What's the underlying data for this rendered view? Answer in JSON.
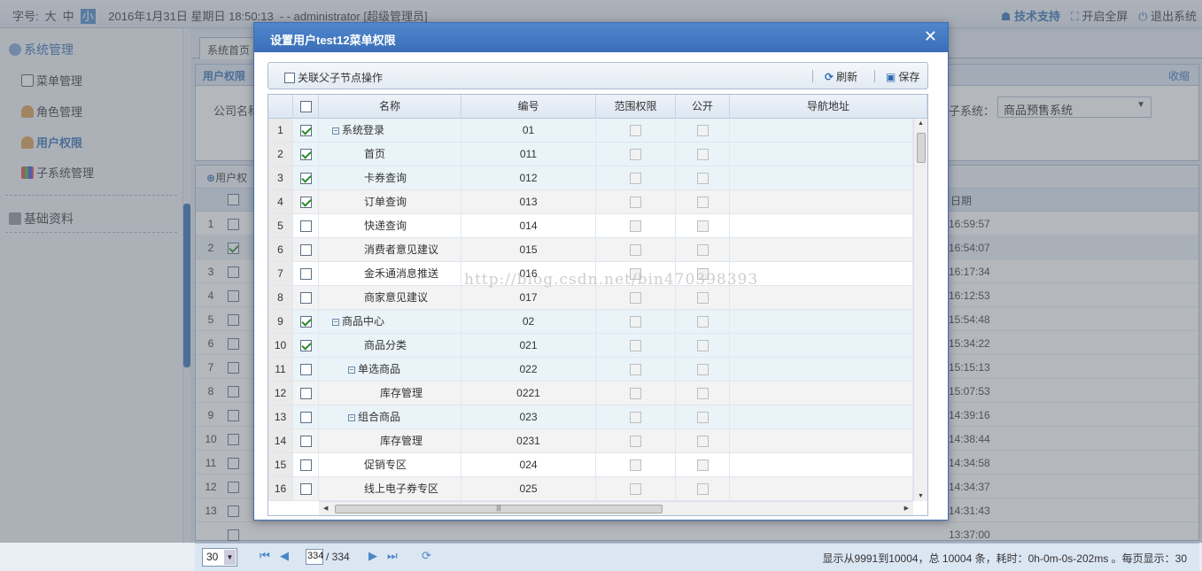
{
  "topbar": {
    "font_label": "字号:",
    "font_large": "大",
    "font_mid": "中",
    "font_small": "小",
    "datetime": "2016年1月31日 星期日 18:50:13",
    "user": "- - administrator [超级管理员]",
    "support": "技术支持",
    "fullscreen": "开启全屏",
    "logout": "退出系统"
  },
  "sidebar": {
    "group1": "系统管理",
    "items": [
      "菜单管理",
      "角色管理",
      "用户权限",
      "子系统管理"
    ],
    "group2": "基础资料"
  },
  "main": {
    "tab": "系统首页",
    "panel_title": "用户权限",
    "collapse": "收缩",
    "company_label": "公司名称",
    "subsystem_label": "子系统：",
    "subsystem_value": "商品预售系统",
    "toolbar_label": "用户权",
    "date_header": "日期"
  },
  "bg_rows": [
    {
      "n": "1",
      "on": false,
      "t": "16:59:57"
    },
    {
      "n": "2",
      "on": true,
      "t": "16:54:07"
    },
    {
      "n": "3",
      "on": false,
      "t": "16:17:34"
    },
    {
      "n": "4",
      "on": false,
      "t": "16:12:53"
    },
    {
      "n": "5",
      "on": false,
      "t": "15:54:48"
    },
    {
      "n": "6",
      "on": false,
      "t": "15:34:22"
    },
    {
      "n": "7",
      "on": false,
      "t": "15:15:13"
    },
    {
      "n": "8",
      "on": false,
      "t": "15:07:53"
    },
    {
      "n": "9",
      "on": false,
      "t": "14:39:16"
    },
    {
      "n": "10",
      "on": false,
      "t": "14:38:44"
    },
    {
      "n": "11",
      "on": false,
      "t": "14:34:58"
    },
    {
      "n": "12",
      "on": false,
      "t": "14:34:37"
    },
    {
      "n": "13",
      "on": false,
      "t": "14:31:43"
    },
    {
      "n": "",
      "on": false,
      "t": "13:37:00"
    }
  ],
  "pager": {
    "page_size": "30",
    "current": "334",
    "total": "/ 334",
    "info": "显示从9991到10004，总 10004 条，耗时：0h-0m-0s-202ms 。每页显示：30"
  },
  "dialog": {
    "title": "设置用户test12菜单权限",
    "link_label": "关联父子节点操作",
    "refresh": "刷新",
    "save": "保存",
    "headers": [
      "名称",
      "编号",
      "范围权限",
      "公开",
      "导航地址"
    ],
    "rows": [
      {
        "n": "1",
        "on": true,
        "name": "系统登录",
        "code": "01",
        "lvl": 0,
        "tg": "−"
      },
      {
        "n": "2",
        "on": true,
        "name": "首页",
        "code": "011",
        "lvl": 1,
        "tg": ""
      },
      {
        "n": "3",
        "on": true,
        "name": "卡券查询",
        "code": "012",
        "lvl": 1,
        "tg": ""
      },
      {
        "n": "4",
        "on": true,
        "name": "订单查询",
        "code": "013",
        "lvl": 1,
        "tg": ""
      },
      {
        "n": "5",
        "on": false,
        "name": "快递查询",
        "code": "014",
        "lvl": 1,
        "tg": ""
      },
      {
        "n": "6",
        "on": false,
        "name": "消费者意见建议",
        "code": "015",
        "lvl": 1,
        "tg": ""
      },
      {
        "n": "7",
        "on": false,
        "name": "金禾通消息推送",
        "code": "016",
        "lvl": 1,
        "tg": ""
      },
      {
        "n": "8",
        "on": false,
        "name": "商家意见建议",
        "code": "017",
        "lvl": 1,
        "tg": ""
      },
      {
        "n": "9",
        "on": true,
        "name": "商品中心",
        "code": "02",
        "lvl": 0,
        "tg": "−"
      },
      {
        "n": "10",
        "on": true,
        "name": "商品分类",
        "code": "021",
        "lvl": 1,
        "tg": ""
      },
      {
        "n": "11",
        "on": false,
        "name": "单选商品",
        "code": "022",
        "lvl": 1,
        "tg": "−"
      },
      {
        "n": "12",
        "on": false,
        "name": "库存管理",
        "code": "0221",
        "lvl": 2,
        "tg": ""
      },
      {
        "n": "13",
        "on": false,
        "name": "组合商品",
        "code": "023",
        "lvl": 1,
        "tg": "−"
      },
      {
        "n": "14",
        "on": false,
        "name": "库存管理",
        "code": "0231",
        "lvl": 2,
        "tg": ""
      },
      {
        "n": "15",
        "on": false,
        "name": "促销专区",
        "code": "024",
        "lvl": 1,
        "tg": ""
      },
      {
        "n": "16",
        "on": false,
        "name": "线上电子券专区",
        "code": "025",
        "lvl": 1,
        "tg": ""
      }
    ]
  },
  "watermark": "http://blog.csdn.net/bin470398393",
  "colors": {
    "accent": "#2f6ab0",
    "dialog_header": "#3a6fb8",
    "check": "#2a8a2a"
  }
}
